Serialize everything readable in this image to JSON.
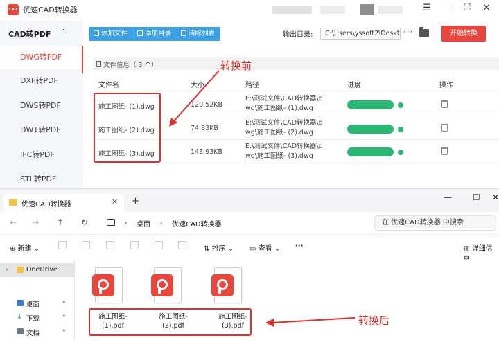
{
  "app": {
    "logo_text": "CAD",
    "title": "优速CAD转换器",
    "window_controls": [
      "☰",
      "—",
      "⛶",
      "✕"
    ],
    "accent_color": "#e8453c"
  },
  "sidebar": {
    "header": "CAD转PDF",
    "items": [
      {
        "label": "DWG转PDF",
        "active": true
      },
      {
        "label": "DXF转PDF",
        "active": false
      },
      {
        "label": "DWS转PDF",
        "active": false
      },
      {
        "label": "DWT转PDF",
        "active": false
      },
      {
        "label": "IFC转PDF",
        "active": false
      },
      {
        "label": "STL转PDF",
        "active": false
      }
    ]
  },
  "toolbar": {
    "add_file": "添加文件",
    "add_folder": "添加目录",
    "clear_list": "清除列表",
    "output_label": "输出目录:",
    "output_path": "C:\\Users\\yssoft2\\Deskt",
    "start_button": "开始转换"
  },
  "file_info": {
    "label": "文件信息（ 3 个）"
  },
  "table": {
    "headers": {
      "name": "文件名",
      "size": "大小",
      "path": "路径",
      "progress": "进度",
      "action": "操作"
    },
    "rows": [
      {
        "name": "施工图纸- (1).dwg",
        "size": "120.52KB",
        "path_1": "E:\\测试文件\\CAD转换器\\d",
        "path_2": "wg\\施工图纸- (1).dwg",
        "progress": 1.0
      },
      {
        "name": "施工图纸- (2).dwg",
        "size": "74.83KB",
        "path_1": "E:\\测试文件\\CAD转换器\\d",
        "path_2": "wg\\施工图纸- (2).dwg",
        "progress": 1.0
      },
      {
        "name": "施工图纸- (3).dwg",
        "size": "143.93KB",
        "path_1": "E:\\测试文件\\CAD转换器\\d",
        "path_2": "wg\\施工图纸- (3).dwg",
        "progress": 1.0
      }
    ],
    "progress_color": "#2bb673"
  },
  "annotations": {
    "before": "转换前",
    "after": "转换后",
    "color": "#e0302a"
  },
  "explorer": {
    "tab_title": "优速CAD转换器",
    "tab_close": "✕",
    "tab_add": "+",
    "window_controls": [
      "—",
      "☐",
      "✕"
    ],
    "nav_icons": [
      "←",
      "→",
      "↑",
      "↻"
    ],
    "breadcrumb": [
      "桌面",
      "优速CAD转换器"
    ],
    "search_placeholder": "在 优速CAD转换器 中搜索",
    "commands": {
      "new": "新建",
      "sort": "排序",
      "view": "查看",
      "more": "···",
      "details": "详细信息"
    },
    "nav_pane": [
      {
        "label": "OneDrive",
        "icon_color": "#f5c343"
      },
      {
        "label": "桌面",
        "icon_color": "#3a7bd5"
      },
      {
        "label": "下载",
        "icon_color": "#2b9a5b"
      },
      {
        "label": "文档",
        "icon_color": "#6b7a90"
      }
    ],
    "files": [
      {
        "line1": "施工图纸-",
        "line2": "(1).pdf"
      },
      {
        "line1": "施工图纸-",
        "line2": "(2).pdf"
      },
      {
        "line1": "施工图纸-",
        "line2": "(3).pdf"
      }
    ],
    "pdf_icon_color": "#e8453c"
  }
}
